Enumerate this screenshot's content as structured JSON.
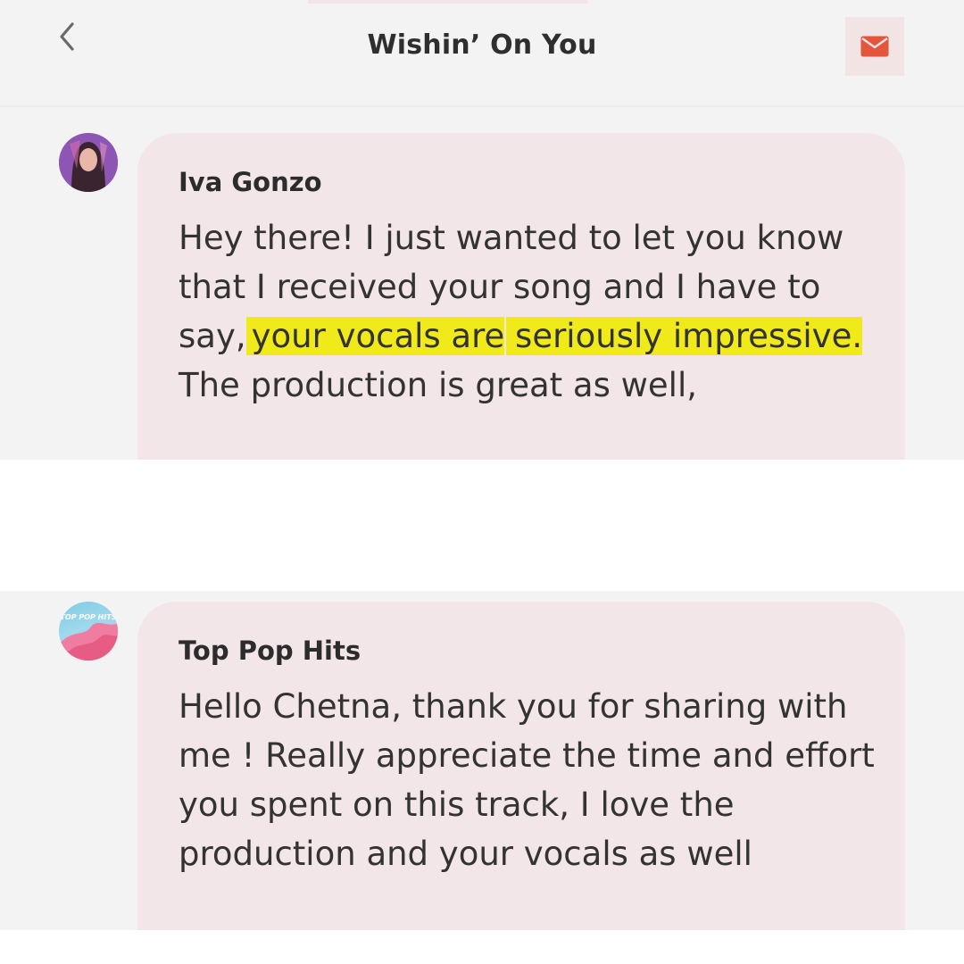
{
  "header": {
    "title": "Wishin’ On You"
  },
  "icons": {
    "back": "chevron-left-icon",
    "mail": "envelope-icon"
  },
  "colors": {
    "accent": "#e4563b",
    "highlight": "#f1ea1a",
    "bubble": "#f2e6e8",
    "background": "#f3f3f4"
  },
  "messages": [
    {
      "sender": "Iva Gonzo",
      "text": {
        "before": "Hey there! I just wanted to let you know that I received your song and I have to say,",
        "highlight_1": "your vocals are",
        "highlight_2": "seriously impressive.",
        "after": " The production is great as well,"
      }
    },
    {
      "sender": "Top Pop Hits",
      "avatar_text": "TOP POP HITS",
      "text": "Hello Chetna, thank you for sharing with me ! Really appreciate the time and effort you spent on this track, I love the production and your vocals as well"
    }
  ]
}
